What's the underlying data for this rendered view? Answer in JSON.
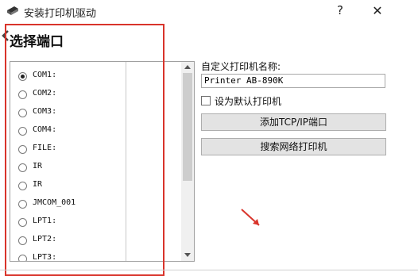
{
  "window": {
    "title": "安装打印机驱动",
    "help_label": "?",
    "close_label": "✕"
  },
  "heading": "选择端口",
  "ports": [
    {
      "label": "COM1:",
      "selected": true
    },
    {
      "label": "COM2:",
      "selected": false
    },
    {
      "label": "COM3:",
      "selected": false
    },
    {
      "label": "COM4:",
      "selected": false
    },
    {
      "label": "FILE:",
      "selected": false
    },
    {
      "label": "IR",
      "selected": false
    },
    {
      "label": "IR",
      "selected": false
    },
    {
      "label": "JMCOM_001",
      "selected": false
    },
    {
      "label": "LPT1:",
      "selected": false
    },
    {
      "label": "LPT2:",
      "selected": false
    },
    {
      "label": "LPT3:",
      "selected": false
    }
  ],
  "right_panel": {
    "custom_name_label": "自定义打印机名称:",
    "printer_name_value": "Printer AB-890K",
    "default_checkbox_label": "设为默认打印机",
    "default_checked": false,
    "add_tcp_button": "添加TCP/IP端口",
    "search_button": "搜索网络打印机"
  },
  "colors": {
    "highlight": "#d9342b",
    "button_bg": "#e3e3e3"
  }
}
